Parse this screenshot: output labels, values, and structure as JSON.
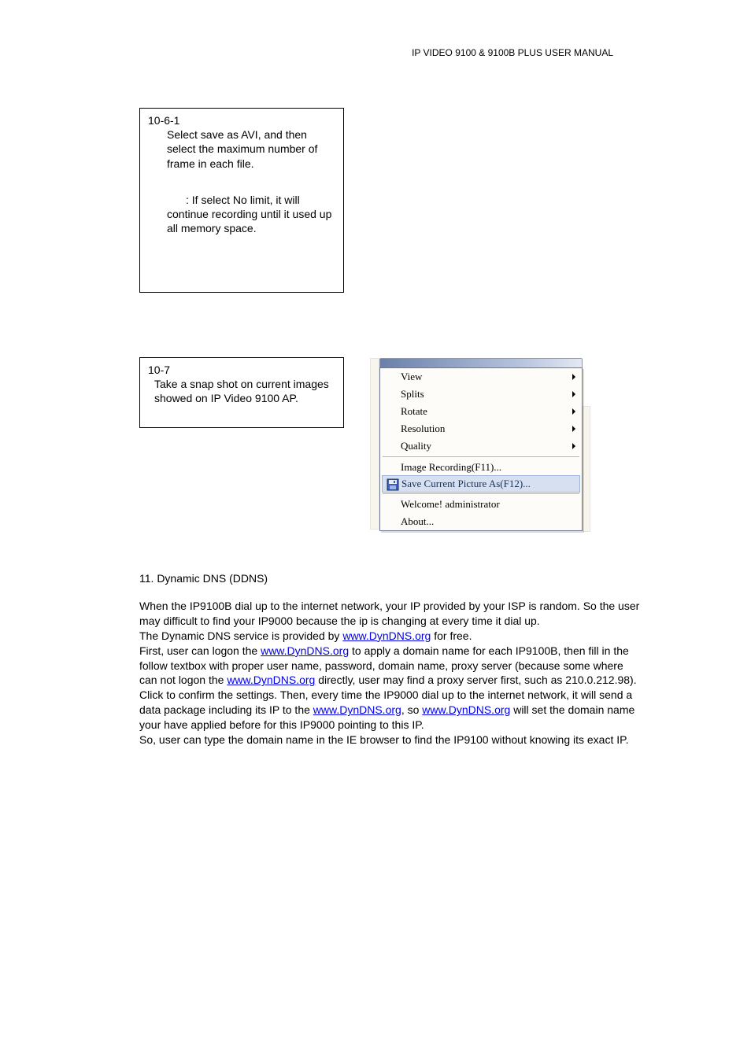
{
  "header": "IP VIDEO 9100 &  9100B PLUS  USER MANUAL",
  "box1": {
    "num": "10-6-1",
    "line1": "Select save as AVI, and then select the maximum number of frame in each file.",
    "note": ": If select No limit, it will continue recording until it used up all memory space."
  },
  "box2": {
    "num": "10-7",
    "line1": "Take a snap shot on current images showed on IP Video 9100 AP."
  },
  "menu": {
    "items": [
      {
        "label": "View",
        "sub": true
      },
      {
        "label": "Splits",
        "sub": true
      },
      {
        "label": "Rotate",
        "sub": true
      },
      {
        "label": "Resolution",
        "sub": true
      },
      {
        "label": "Quality",
        "sub": true
      }
    ],
    "image_recording": "Image Recording(F11)...",
    "save_current": "Save Current Picture As(F12)...",
    "welcome": "Welcome! administrator",
    "about": "About..."
  },
  "section11": {
    "title": "11. Dynamic DNS (DDNS)",
    "p1_a": "When the IP9100B dial up to the internet network, your IP provided by your ISP is random. So the user may difficult to find your IP9000 because the ip is changing at every time it dial up.",
    "p2_a": "The Dynamic DNS service is provided by ",
    "p2_b": " for free.",
    "p3_a": "First, user can logon the ",
    "p3_b": " to apply a domain name for each IP9100B, then fill in the follow textbox with proper user name, password, domain name, proxy server (because some where can not logon the ",
    "p3_c": " directly, user may find a proxy server first, such as 210.0.212.98). Click ",
    "p3_d": " to confirm the settings. Then, every time the IP9000 dial up to the internet network, it will send a data package including its IP to the ",
    "p3_e": ", so ",
    "p3_f": " will set the domain name your have applied before for this IP9000 pointing to this IP.",
    "p4": "So, user can type the domain name in the IE browser to find the IP9100 without knowing its exact IP.",
    "link": "www.DynDNS.org"
  }
}
